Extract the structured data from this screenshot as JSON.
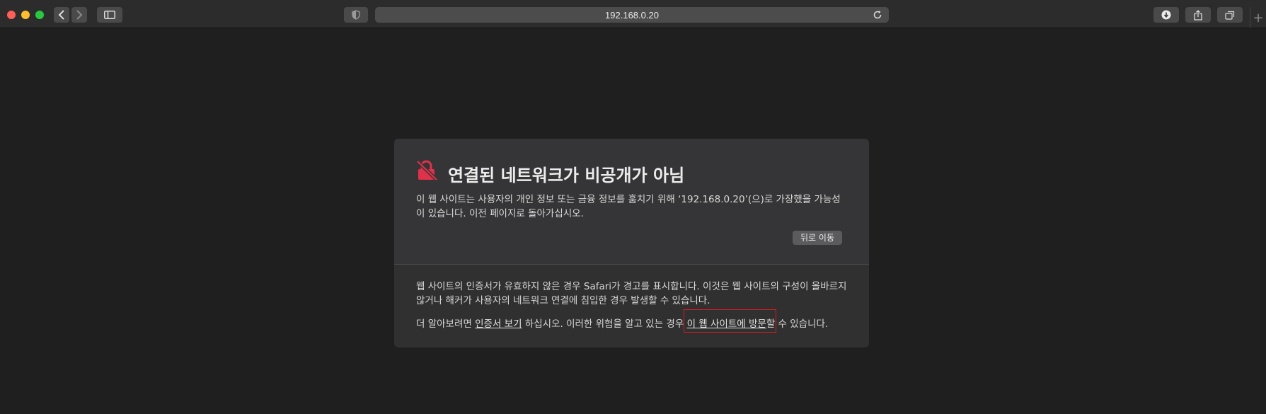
{
  "browser": {
    "url": "192.168.0.20",
    "colors": {
      "toolbar": "#2c2c2c",
      "address_bar": "#4c4c4c",
      "page_bg": "#1f1f1f"
    }
  },
  "warning": {
    "title": "연결된 네트워크가 비공개가 아님",
    "description": "이 웹 사이트는 사용자의 개인 정보 또는 금융 정보를 훔치기 위해 ‘192.168.0.20’(으)로 가장했을 가능성이 있습니다. 이전 페이지로 돌아가십시오.",
    "back_button": "뒤로 이동",
    "info_text": "웹 사이트의 인증서가 유효하지 않은 경우 Safari가 경고를 표시합니다. 이것은 웹 사이트의 구성이 올바르지 않거나 해커가 사용자의 네트워크 연결에 침입한 경우 발생할 수 있습니다.",
    "more_prefix": "더 알아보려면 ",
    "view_certificate_link": "인증서 보기",
    "more_middle": " 하십시오. 이러한 위험을 알고 있는 경우 ",
    "visit_link": "이 웹 사이트에 방문",
    "more_suffix": "할 수 있습니다.",
    "icon": "broken-lock-icon",
    "accent_color": "#e0314a",
    "highlight_color": "#d21e1e"
  }
}
